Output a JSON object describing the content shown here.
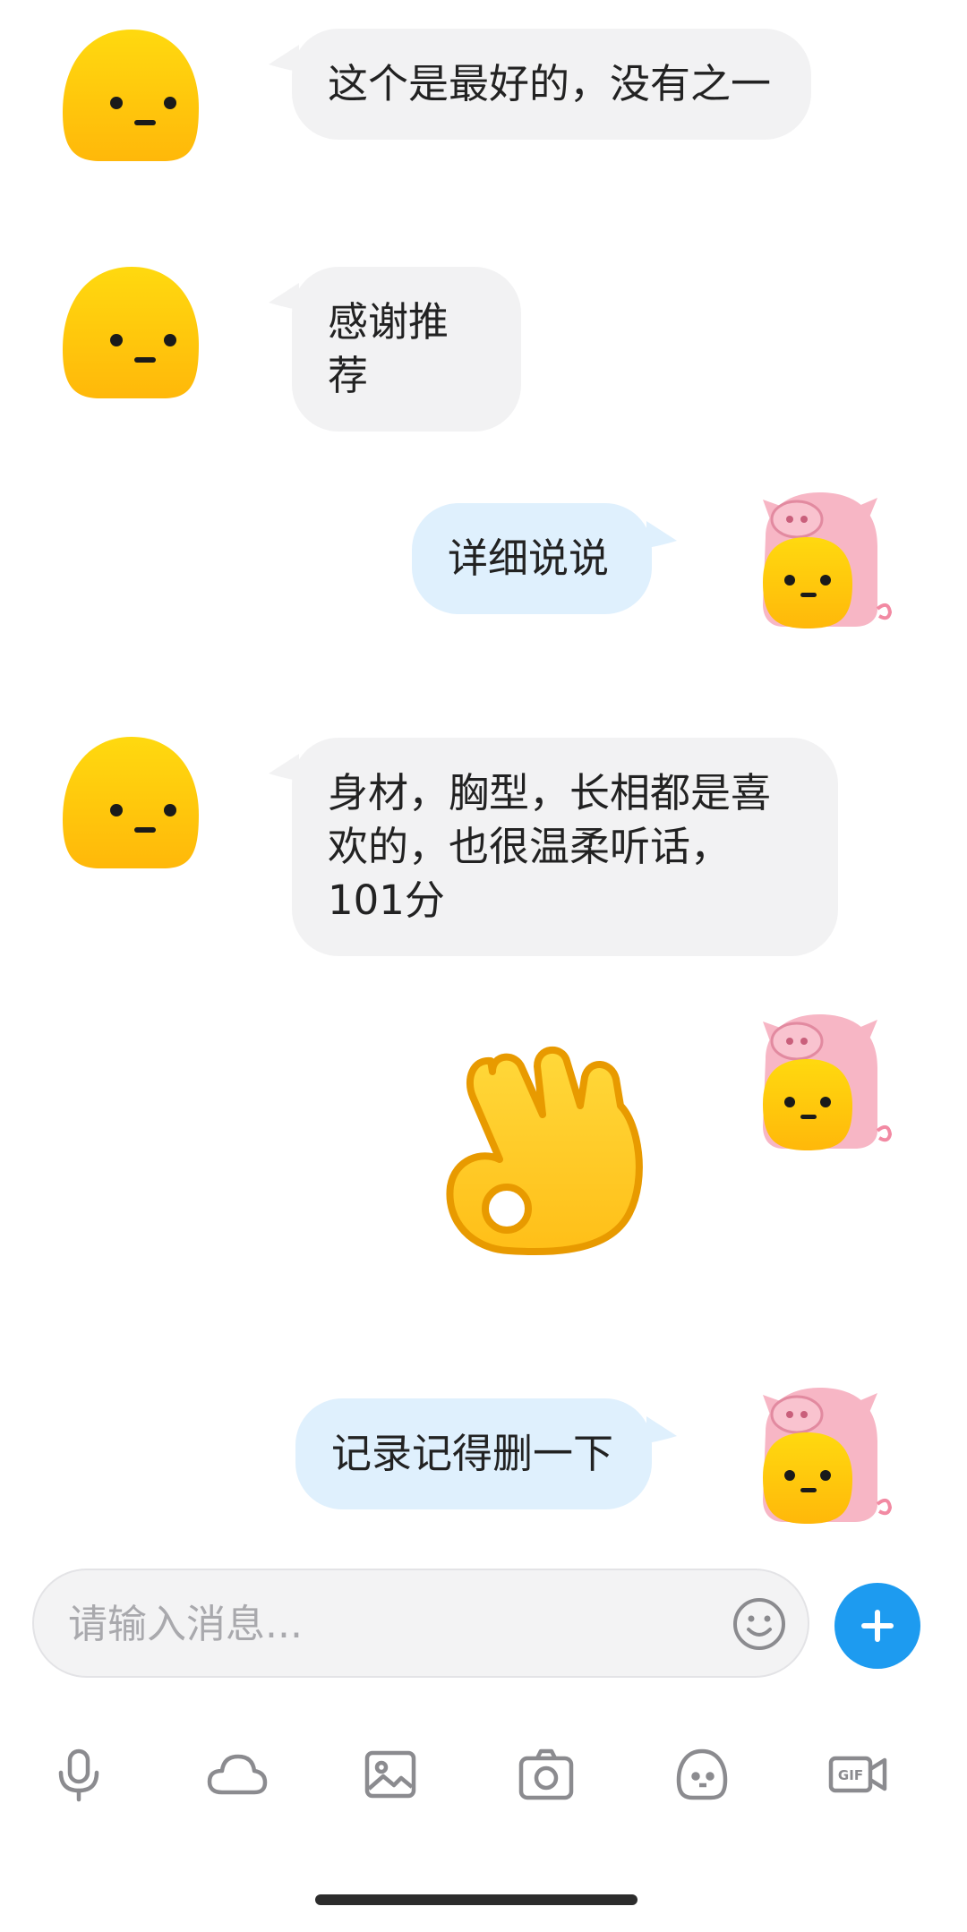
{
  "messages": [
    {
      "from": "them",
      "text": "这个是最好的，没有之一"
    },
    {
      "from": "them",
      "text": "感谢推荐"
    },
    {
      "from": "me",
      "text": "详细说说"
    },
    {
      "from": "them",
      "text": "身材，胸型，长相都是喜欢的，也很温柔听话，101分"
    },
    {
      "from": "me",
      "sticker": "ok-hand-sticker"
    },
    {
      "from": "me",
      "text": "记录记得删一下"
    }
  ],
  "composer": {
    "placeholder": "请输入消息..."
  },
  "toolbar": {
    "icons": [
      "microphone-icon",
      "cloud-icon",
      "image-icon",
      "camera-icon",
      "emoji-icon",
      "gif-icon"
    ]
  },
  "colors": {
    "incoming_bubble": "#f2f2f3",
    "outgoing_bubble": "#dff0fd",
    "accent": "#1d9bf0",
    "avatar_yellow": "#ffcf0f",
    "pig_pink": "#f7b6c5"
  }
}
